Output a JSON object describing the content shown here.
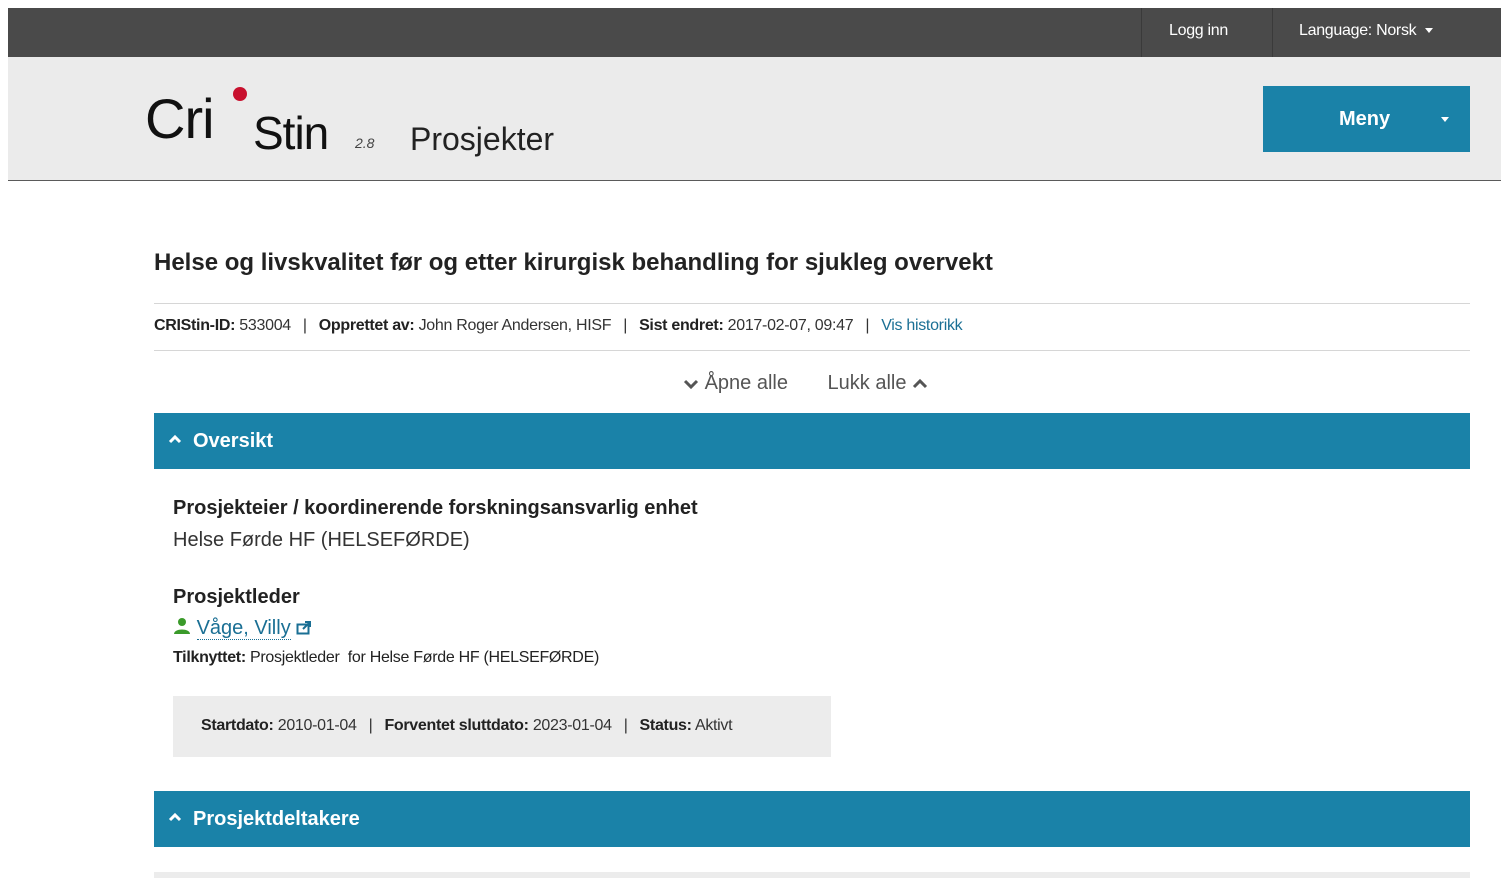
{
  "topbar": {
    "login_label": "Logg inn",
    "language_label": "Language: Norsk"
  },
  "header": {
    "logo": {
      "part1": "Cri",
      "part2": "Stin",
      "version": "2.8"
    },
    "app_title": "Prosjekter",
    "menu_label": "Meny"
  },
  "project": {
    "title": "Helse og livskvalitet før og etter kirurgisk behandling for sjukleg overvekt",
    "meta": {
      "id_label": "CRIStin-ID:",
      "id_value": "533004",
      "created_label": "Opprettet av:",
      "created_value": "John Roger Andersen, HISF",
      "changed_label": "Sist endret:",
      "changed_value": "2017-02-07, 09:47",
      "history_link": "Vis historikk"
    }
  },
  "toggles": {
    "open_all": "Åpne alle",
    "close_all": "Lukk alle"
  },
  "overview": {
    "heading": "Oversikt",
    "owner_label": "Prosjekteier / koordinerende forskningsansvarlig enhet",
    "owner_value": "Helse Førde HF (HELSEFØRDE)",
    "leader_label": "Prosjektleder",
    "leader_name": "Våge, Villy",
    "affiliation_label": "Tilknyttet:",
    "affiliation_value": "Prosjektleder  for Helse Førde HF (HELSEFØRDE)",
    "dates": {
      "start_label": "Startdato:",
      "start_value": "2010-01-04",
      "end_label": "Forventet sluttdato:",
      "end_value": "2023-01-04",
      "status_label": "Status:",
      "status_value": "Aktivt"
    }
  },
  "participants": {
    "heading": "Prosjektdeltakere"
  },
  "colors": {
    "topbar": "#4a4a4a",
    "header_bg": "#ebebeb",
    "accent": "#1a82a8",
    "link": "#1a6f94",
    "logo_dot": "#c8102e",
    "person_icon": "#3a9a2a"
  }
}
